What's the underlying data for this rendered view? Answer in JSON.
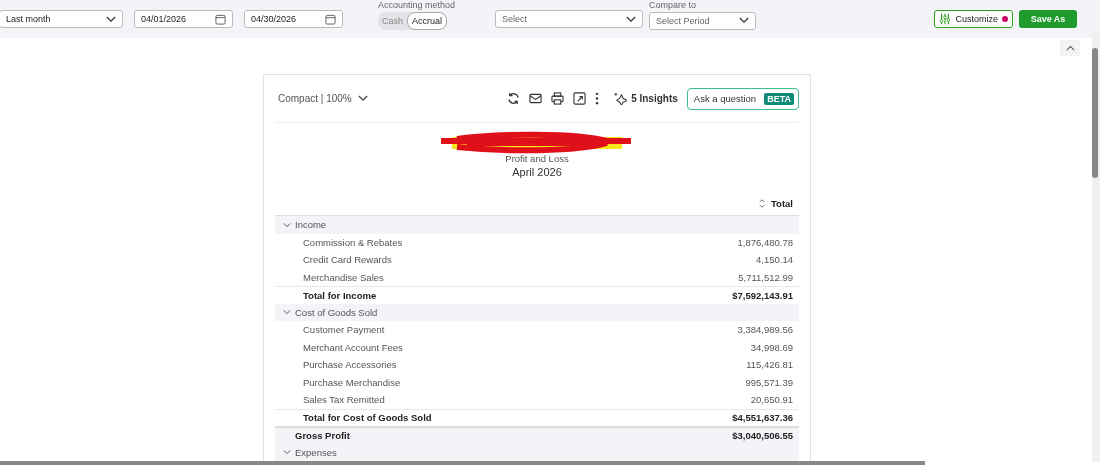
{
  "filters": {
    "period": {
      "value": "Last month"
    },
    "start_date": {
      "value": "04/01/2026"
    },
    "end_date": {
      "value": "04/30/2026"
    },
    "accounting_method": {
      "label": "Accounting method",
      "options": [
        {
          "label": "Cash",
          "selected": false
        },
        {
          "label": "Accrual",
          "selected": true
        }
      ]
    },
    "display_columns": {
      "placeholder": "Select"
    },
    "compare_to": {
      "label": "Compare to",
      "placeholder": "Select Period"
    }
  },
  "actions": {
    "customize": {
      "label": "Customize",
      "notification": true
    },
    "save": {
      "label": "Save As"
    }
  },
  "report_toolbar": {
    "view": "Compact | 100%",
    "insights": "5 Insights",
    "ask": {
      "label": "Ask a question",
      "badge": "BETA"
    }
  },
  "report": {
    "subtitle": "Profit and Loss",
    "period": "April 2026",
    "column": "Total",
    "sections": [
      {
        "label": "Income",
        "expanded": true,
        "children": [
          {
            "label": "Commission & Rebates",
            "amount": "1,876,480.78"
          },
          {
            "label": "Credit Card Rewards",
            "amount": "4,150.14"
          },
          {
            "label": "Merchandise Sales",
            "amount": "5,711,512.99"
          }
        ],
        "total": {
          "label": "Total for Income",
          "amount": "$7,592,143.91"
        }
      },
      {
        "label": "Cost of Goods Sold",
        "expanded": true,
        "children": [
          {
            "label": "Customer Payment",
            "amount": "3,384,989.56"
          },
          {
            "label": "Merchant Account Fees",
            "amount": "34,998.69"
          },
          {
            "label": "Purchase Accessories",
            "amount": "115,426.81"
          },
          {
            "label": "Purchase Merchandise",
            "amount": "995,571.39"
          },
          {
            "label": "Sales Tax Remitted",
            "amount": "20,650.91"
          }
        ],
        "total": {
          "label": "Total for Cost of Goods Sold",
          "amount": "$4,551,637.36"
        }
      },
      {
        "kind": "summary",
        "label": "Gross Profit",
        "amount": "$3,040,506.55"
      },
      {
        "label": "Expenses",
        "expanded": true
      }
    ]
  }
}
